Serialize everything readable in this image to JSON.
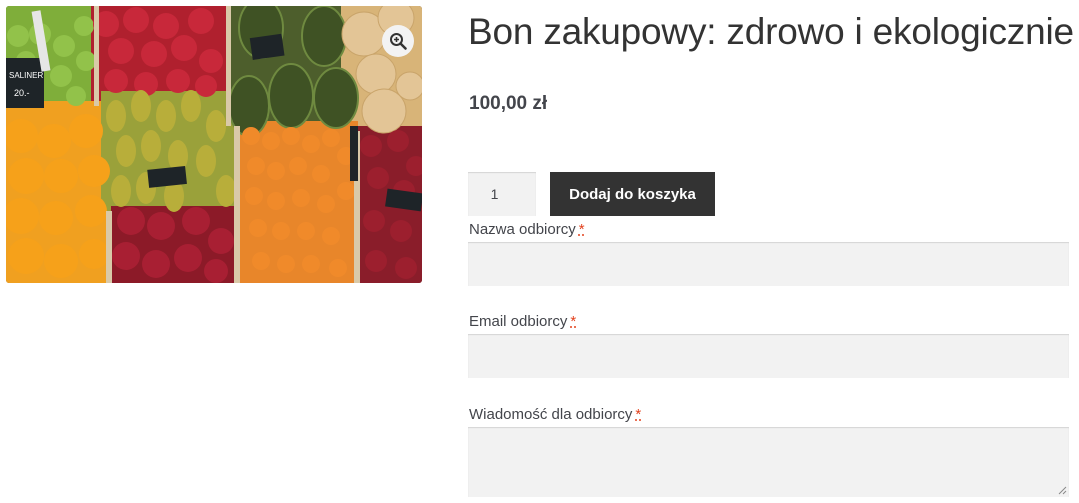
{
  "product": {
    "title": "Bon zakupowy: zdrowo i ekologicznie",
    "price": "100,00 zł",
    "image_icon": "zoom-in-icon"
  },
  "cart": {
    "quantity": "1",
    "add_to_cart_label": "Dodaj do koszyka"
  },
  "form": {
    "required_marker": "*",
    "fields": [
      {
        "label": "Nazwa odbiorcy",
        "value": ""
      },
      {
        "label": "Email odbiorcy",
        "value": ""
      },
      {
        "label": "Wiadomość dla odbiorcy",
        "value": ""
      }
    ]
  },
  "image_signs": [
    "SALINER",
    "20.-"
  ]
}
